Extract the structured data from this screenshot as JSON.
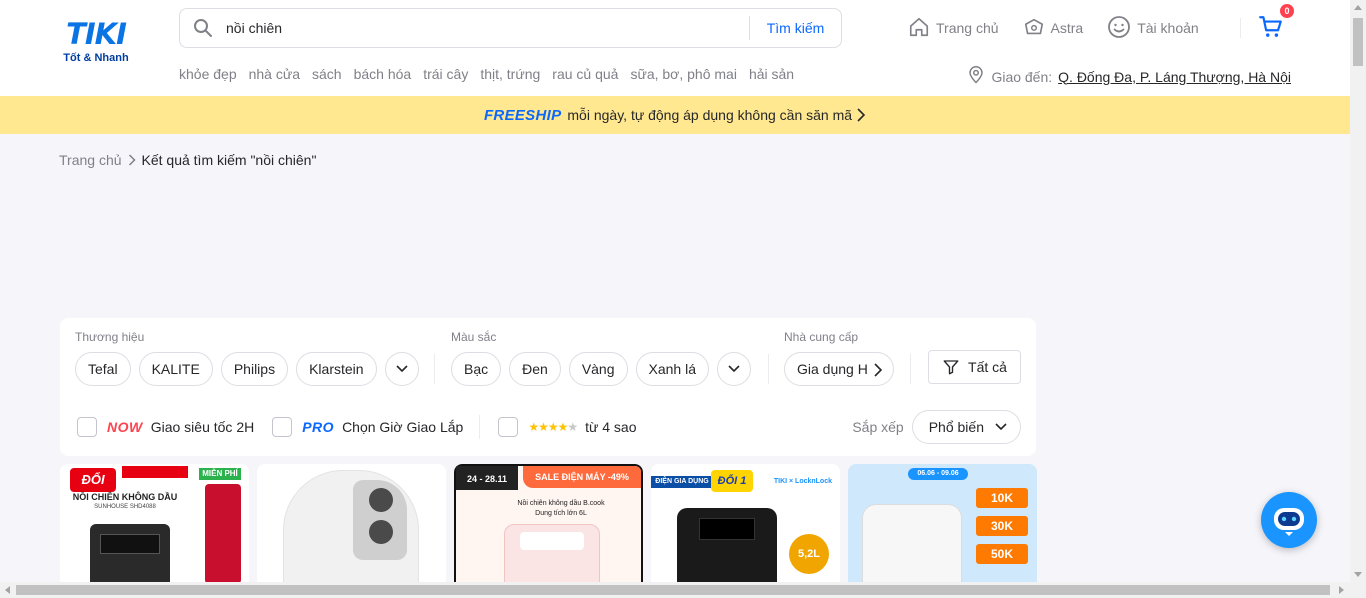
{
  "logo": {
    "word": "TIKI",
    "tagline": "Tốt & Nhanh"
  },
  "search": {
    "value": "nồi chiên",
    "button": "Tìm kiếm"
  },
  "nav": {
    "home": "Trang chủ",
    "astra": "Astra",
    "account": "Tài khoản",
    "cart_count": "0"
  },
  "quick_links": [
    "khỏe đẹp",
    "nhà cửa",
    "sách",
    "bách hóa",
    "trái cây",
    "thịt, trứng",
    "rau củ quả",
    "sữa, bơ, phô mai",
    "hải sản"
  ],
  "location": {
    "label": "Giao đến:",
    "address": "Q. Đống Đa, P. Láng Thượng, Hà Nội"
  },
  "banner": {
    "freeship": "FREESHIP",
    "text": "mỗi ngày, tự động áp dụng không cần săn mã"
  },
  "breadcrumb": {
    "home": "Trang chủ",
    "current": "Kết quả tìm kiếm \"nồi chiên\""
  },
  "filters": {
    "brand": {
      "label": "Thương hiệu",
      "options": [
        "Tefal",
        "KALITE",
        "Philips",
        "Klarstein"
      ]
    },
    "color": {
      "label": "Màu sắc",
      "options": [
        "Bạc",
        "Đen",
        "Vàng",
        "Xanh lá"
      ]
    },
    "supplier": {
      "label": "Nhà cung cấp",
      "options": [
        "Gia dụng H"
      ]
    },
    "all_button": "Tất cả",
    "now": {
      "badge": "NOW",
      "text": "Giao siêu tốc 2H"
    },
    "pro": {
      "badge": "PRO",
      "text": "Chọn Giờ Giao Lắp"
    },
    "rating": {
      "stars": 4,
      "text": "từ 4 sao"
    },
    "sort": {
      "label": "Sắp xếp",
      "value": "Phổ biến"
    }
  },
  "products": [
    {
      "title": "NỒI CHIÊN KHÔNG DẦU",
      "subtitle": "SUNHOUSE SHD4088",
      "badge": "ĐỔI",
      "tag": "MIỄN PHÍ"
    },
    {
      "title": "",
      "subtitle": "",
      "badge": "",
      "tag": ""
    },
    {
      "title": "Nồi chiên không dầu B.cook",
      "subtitle": "Dung tích lớn 6L",
      "badge": "24 - 28.11",
      "tag": "SALE ĐIỆN MÁY -49%"
    },
    {
      "title": "ĐIỆN GIA DỤNG",
      "subtitle": "5,2L",
      "badge": "ĐỔI 1",
      "tag": "TIKI × LocknLock"
    },
    {
      "title": "06.06 - 09.06",
      "subtitle": "",
      "badge": "10K",
      "tag": "30K",
      "extra": "50K"
    }
  ],
  "colors": {
    "accent": "#1a94ff",
    "brand_blue": "#0a68ff",
    "banner_yellow": "#ffe88f",
    "red": "#ff424e"
  }
}
